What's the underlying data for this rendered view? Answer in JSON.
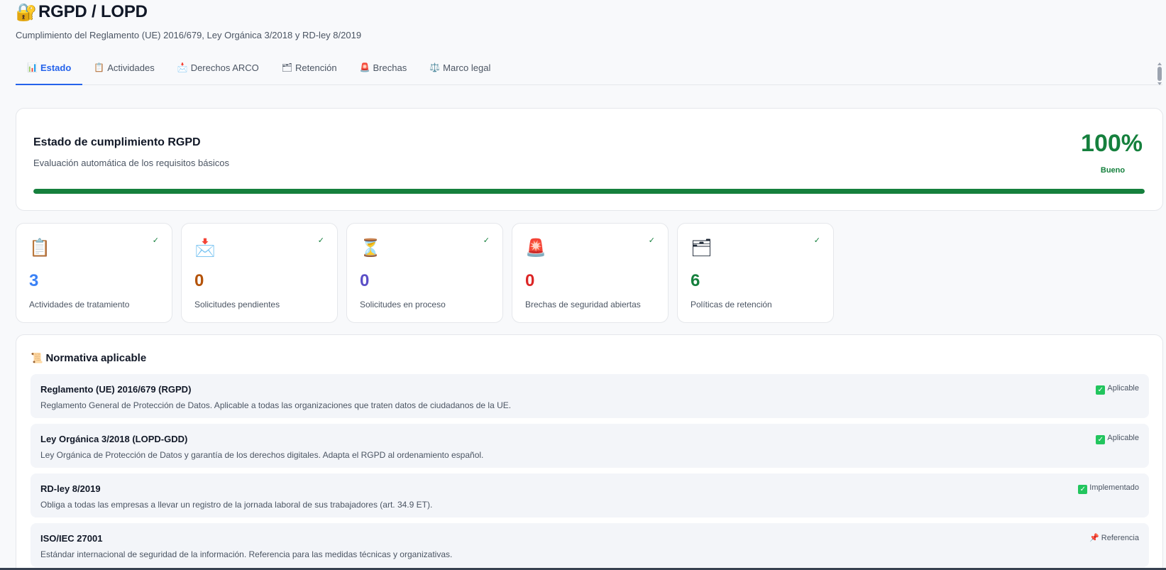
{
  "header": {
    "icon": "🔐",
    "title": "RGPD / LOPD",
    "subtitle": "Cumplimiento del Reglamento (UE) 2016/679, Ley Orgánica 3/2018 y RD-ley 8/2019"
  },
  "tabs": [
    {
      "icon": "📊",
      "label": "Estado",
      "active": true
    },
    {
      "icon": "📋",
      "label": "Actividades",
      "active": false
    },
    {
      "icon": "📩",
      "label": "Derechos ARCO",
      "active": false
    },
    {
      "icon": "🗂",
      "label": "Retención",
      "active": false
    },
    {
      "icon": "🚨",
      "label": "Brechas",
      "active": false
    },
    {
      "icon": "⚖️",
      "label": "Marco legal",
      "active": false
    }
  ],
  "status": {
    "title": "Estado de cumplimiento RGPD",
    "subtitle": "Evaluación automática de los requisitos básicos",
    "score": "100%",
    "score_label": "Bueno",
    "progress": 1.0,
    "color": "#15803d"
  },
  "stats": [
    {
      "icon": "📋",
      "value": "3",
      "label": "Actividades de tratamiento",
      "color": "#3b82f6",
      "check": "✓",
      "icon_name": "clipboard-icon"
    },
    {
      "icon": "📩",
      "value": "0",
      "label": "Solicitudes pendientes",
      "color": "#b45309",
      "check": "✓",
      "icon_name": "envelope-arrow-icon"
    },
    {
      "icon": "⏳",
      "value": "0",
      "label": "Solicitudes en proceso",
      "color": "#5b4fc7",
      "check": "✓",
      "icon_name": "hourglass-icon"
    },
    {
      "icon": "🚨",
      "value": "0",
      "label": "Brechas de seguridad abiertas",
      "color": "#dc2626",
      "check": "✓",
      "icon_name": "siren-icon"
    },
    {
      "icon": "🗂",
      "value": "6",
      "label": "Políticas de retención",
      "color": "#15803d",
      "check": "✓",
      "icon_name": "folder-icon"
    }
  ],
  "normativa": {
    "icon": "📜",
    "title": "Normativa aplicable",
    "items": [
      {
        "name": "Reglamento (UE) 2016/679 (RGPD)",
        "desc": "Reglamento General de Protección de Datos. Aplicable a todas las organizaciones que traten datos de ciudadanos de la UE.",
        "status_icon": "✓",
        "status": "Aplicable",
        "kind": "check"
      },
      {
        "name": "Ley Orgánica 3/2018 (LOPD-GDD)",
        "desc": "Ley Orgánica de Protección de Datos y garantía de los derechos digitales. Adapta el RGPD al ordenamiento español.",
        "status_icon": "✓",
        "status": "Aplicable",
        "kind": "check"
      },
      {
        "name": "RD-ley 8/2019",
        "desc": "Obliga a todas las empresas a llevar un registro de la jornada laboral de sus trabajadores (art. 34.9 ET).",
        "status_icon": "✓",
        "status": "Implementado",
        "kind": "check"
      },
      {
        "name": "ISO/IEC 27001",
        "desc": "Estándar internacional de seguridad de la información. Referencia para las medidas técnicas y organizativas.",
        "status_icon": "📌",
        "status": "Referencia",
        "kind": "pin"
      }
    ]
  }
}
